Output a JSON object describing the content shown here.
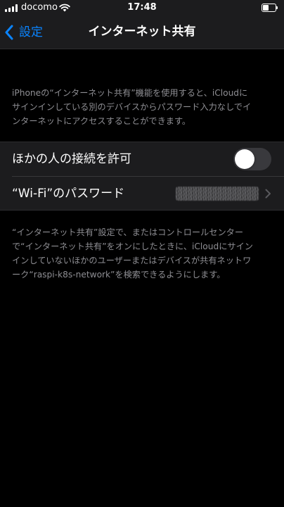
{
  "status_bar": {
    "carrier": "docomo",
    "time": "17:48",
    "signal_icon": "signal-bars-icon",
    "wifi_icon": "wifi-icon",
    "battery_icon": "battery-icon",
    "battery_level": 0.45
  },
  "nav": {
    "back_label": "設定",
    "back_icon": "chevron-left-icon",
    "title": "インターネット共有",
    "accent_color": "#0a84ff"
  },
  "description_top": "iPhoneの“インターネット共有”機能を使用すると、iCloudに\nサインインしている別のデバイスからパスワード入力なしでイ\nンターネットにアクセスすることができます。",
  "settings": {
    "allow_others": {
      "label": "ほかの人の接続を許可",
      "toggle_on": false
    },
    "wifi_password": {
      "label": "“Wi-Fi”のパスワード",
      "value_obscured": true,
      "chevron_icon": "chevron-right-icon"
    }
  },
  "description_bottom": "“インターネット共有”設定で、またはコントロールセンター\nで“インターネット共有”をオンにしたときに、iCloudにサイン\nインしていないほかのユーザーまたはデバイスが共有ネットワ\nーク“raspi-k8s-network”を検索できるようにします。"
}
